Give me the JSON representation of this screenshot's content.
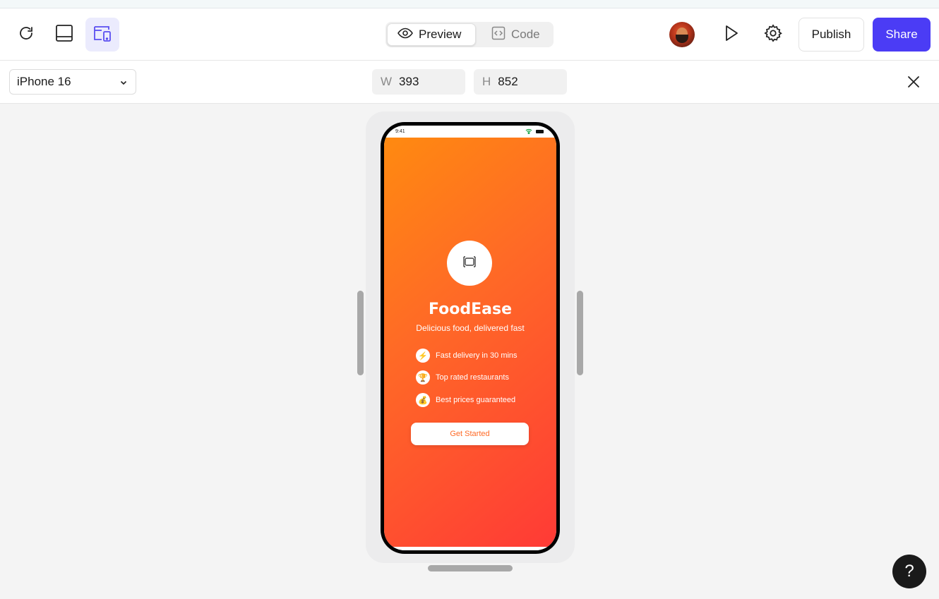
{
  "toolbar": {
    "refresh_icon": "refresh-icon",
    "layout_icon": "panel-bottom-icon",
    "responsive_icon": "device-responsive-icon",
    "tabs": [
      {
        "label": "Preview",
        "icon": "eye-icon",
        "active": true
      },
      {
        "label": "Code",
        "icon": "code-icon",
        "active": false
      }
    ],
    "publish_label": "Publish",
    "share_label": "Share"
  },
  "subbar": {
    "device": "iPhone 16",
    "width_label": "W",
    "width_value": "393",
    "height_label": "H",
    "height_value": "852"
  },
  "phone": {
    "time": "9:41",
    "app_title": "FoodEase",
    "app_subtitle": "Delicious food, delivered fast",
    "features": [
      {
        "icon": "⚡",
        "text": "Fast delivery in 30 mins"
      },
      {
        "icon": "🏆",
        "text": "Top rated restaurants"
      },
      {
        "icon": "💰",
        "text": "Best prices guaranteed"
      }
    ],
    "cta_label": "Get Started"
  },
  "help_label": "?",
  "colors": {
    "accent": "#4b3cf5",
    "gradient_start": "#ff8a10",
    "gradient_end": "#ff3a36"
  }
}
